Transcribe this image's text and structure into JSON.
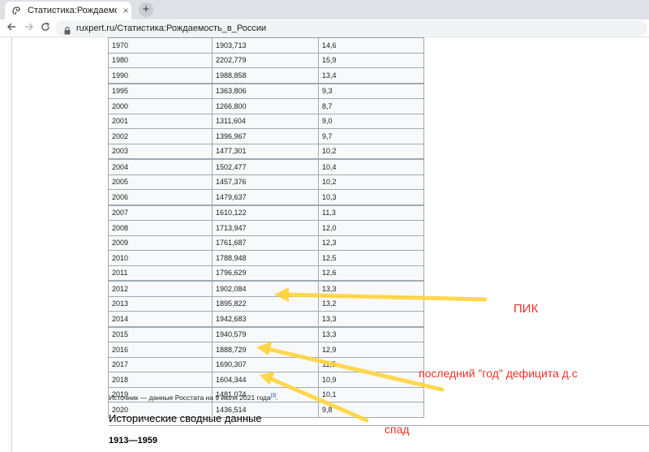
{
  "browser": {
    "tab_title": "Статистика:Рождаемость в Росс",
    "close_glyph": "×",
    "new_tab_glyph": "+",
    "url_domain": "ruxpert.ru",
    "url_path": "/Статистика:Рождаемость_в_России"
  },
  "table": {
    "rows": [
      {
        "year": "1970",
        "births": "1903,713",
        "rate": "14,6"
      },
      {
        "year": "1980",
        "births": "2202,779",
        "rate": "15,9"
      },
      {
        "year": "1990",
        "births": "1988,858",
        "rate": "13,4"
      },
      {
        "year": "1995",
        "births": "1363,806",
        "rate": "9,3"
      },
      {
        "year": "2000",
        "births": "1266,800",
        "rate": "8,7"
      },
      {
        "year": "2001",
        "births": "1311,604",
        "rate": "9,0"
      },
      {
        "year": "2002",
        "births": "1396,967",
        "rate": "9,7"
      },
      {
        "year": "2003",
        "births": "1477,301",
        "rate": "10,2"
      },
      {
        "year": "2004",
        "births": "1502,477",
        "rate": "10,4"
      },
      {
        "year": "2005",
        "births": "1457,376",
        "rate": "10,2"
      },
      {
        "year": "2006",
        "births": "1479,637",
        "rate": "10,3"
      },
      {
        "year": "2007",
        "births": "1610,122",
        "rate": "11,3"
      },
      {
        "year": "2008",
        "births": "1713,947",
        "rate": "12,0"
      },
      {
        "year": "2009",
        "births": "1761,687",
        "rate": "12,3"
      },
      {
        "year": "2010",
        "births": "1788,948",
        "rate": "12,5"
      },
      {
        "year": "2011",
        "births": "1796,629",
        "rate": "12,6"
      },
      {
        "year": "2012",
        "births": "1902,084",
        "rate": "13,3"
      },
      {
        "year": "2013",
        "births": "1895,822",
        "rate": "13,2"
      },
      {
        "year": "2014",
        "births": "1942,683",
        "rate": "13,3"
      },
      {
        "year": "2015",
        "births": "1940,579",
        "rate": "13,3"
      },
      {
        "year": "2016",
        "births": "1888,729",
        "rate": "12,9"
      },
      {
        "year": "2017",
        "births": "1690,307",
        "rate": "11,5"
      },
      {
        "year": "2018",
        "births": "1604,344",
        "rate": "10,9"
      },
      {
        "year": "2019",
        "births": "1481,074",
        "rate": "10,1"
      },
      {
        "year": "2020",
        "births": "1436,514",
        "rate": "9,8"
      }
    ]
  },
  "source": {
    "text": "Источник — данные Росстата на 9 июля 2021 года",
    "ref": "[3]",
    "end": "."
  },
  "headings": {
    "h2": "Исторические сводные данные",
    "h3": "1913—1959"
  },
  "annotations": {
    "peak": "ПИК",
    "deficit": "последний \"год\" дефицита д.с",
    "decline": "спад",
    "arrow_color": "#ffd43b",
    "text_color": "#e8332a"
  }
}
